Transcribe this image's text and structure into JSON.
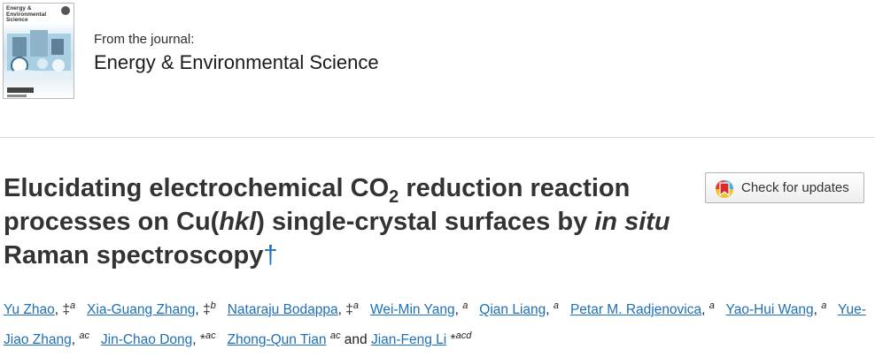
{
  "journal": {
    "cover_title": "Energy & Environmental Science",
    "from_label": "From the journal:",
    "name": "Energy & Environmental Science"
  },
  "article": {
    "title_part1": "Elucidating electrochemical CO",
    "title_sub": "2",
    "title_part2": " reduction reaction processes on Cu(",
    "title_hkl": "hkl",
    "title_part3": ") single-crystal surfaces by ",
    "title_insitu": "in situ",
    "title_part4": " Raman spectroscopy",
    "title_dagger": "†"
  },
  "check_updates": {
    "label": "Check for updates"
  },
  "authors": [
    {
      "name": "Yu Zhao",
      "mark": "‡",
      "aff": "a"
    },
    {
      "name": "Xia-Guang Zhang",
      "mark": "‡",
      "aff": "b"
    },
    {
      "name": "Nataraju Bodappa",
      "mark": "‡",
      "aff": "a"
    },
    {
      "name": "Wei-Min Yang",
      "mark": "",
      "aff": "a"
    },
    {
      "name": "Qian Liang",
      "mark": "",
      "aff": "a"
    },
    {
      "name": "Petar M. Radjenovica",
      "mark": "",
      "aff": "a"
    },
    {
      "name": "Yao-Hui Wang",
      "mark": "",
      "aff": "a"
    },
    {
      "name": "Yue-Jiao Zhang",
      "mark": "",
      "aff": "ac"
    },
    {
      "name": "Jin-Chao Dong",
      "mark": "*",
      "aff": "ac"
    },
    {
      "name": "Zhong-Qun Tian",
      "mark": "",
      "aff": "ac"
    },
    {
      "name": "Jian-Feng Li",
      "mark": "*",
      "aff": "acd"
    }
  ],
  "and_word": "and",
  "comma": ","
}
